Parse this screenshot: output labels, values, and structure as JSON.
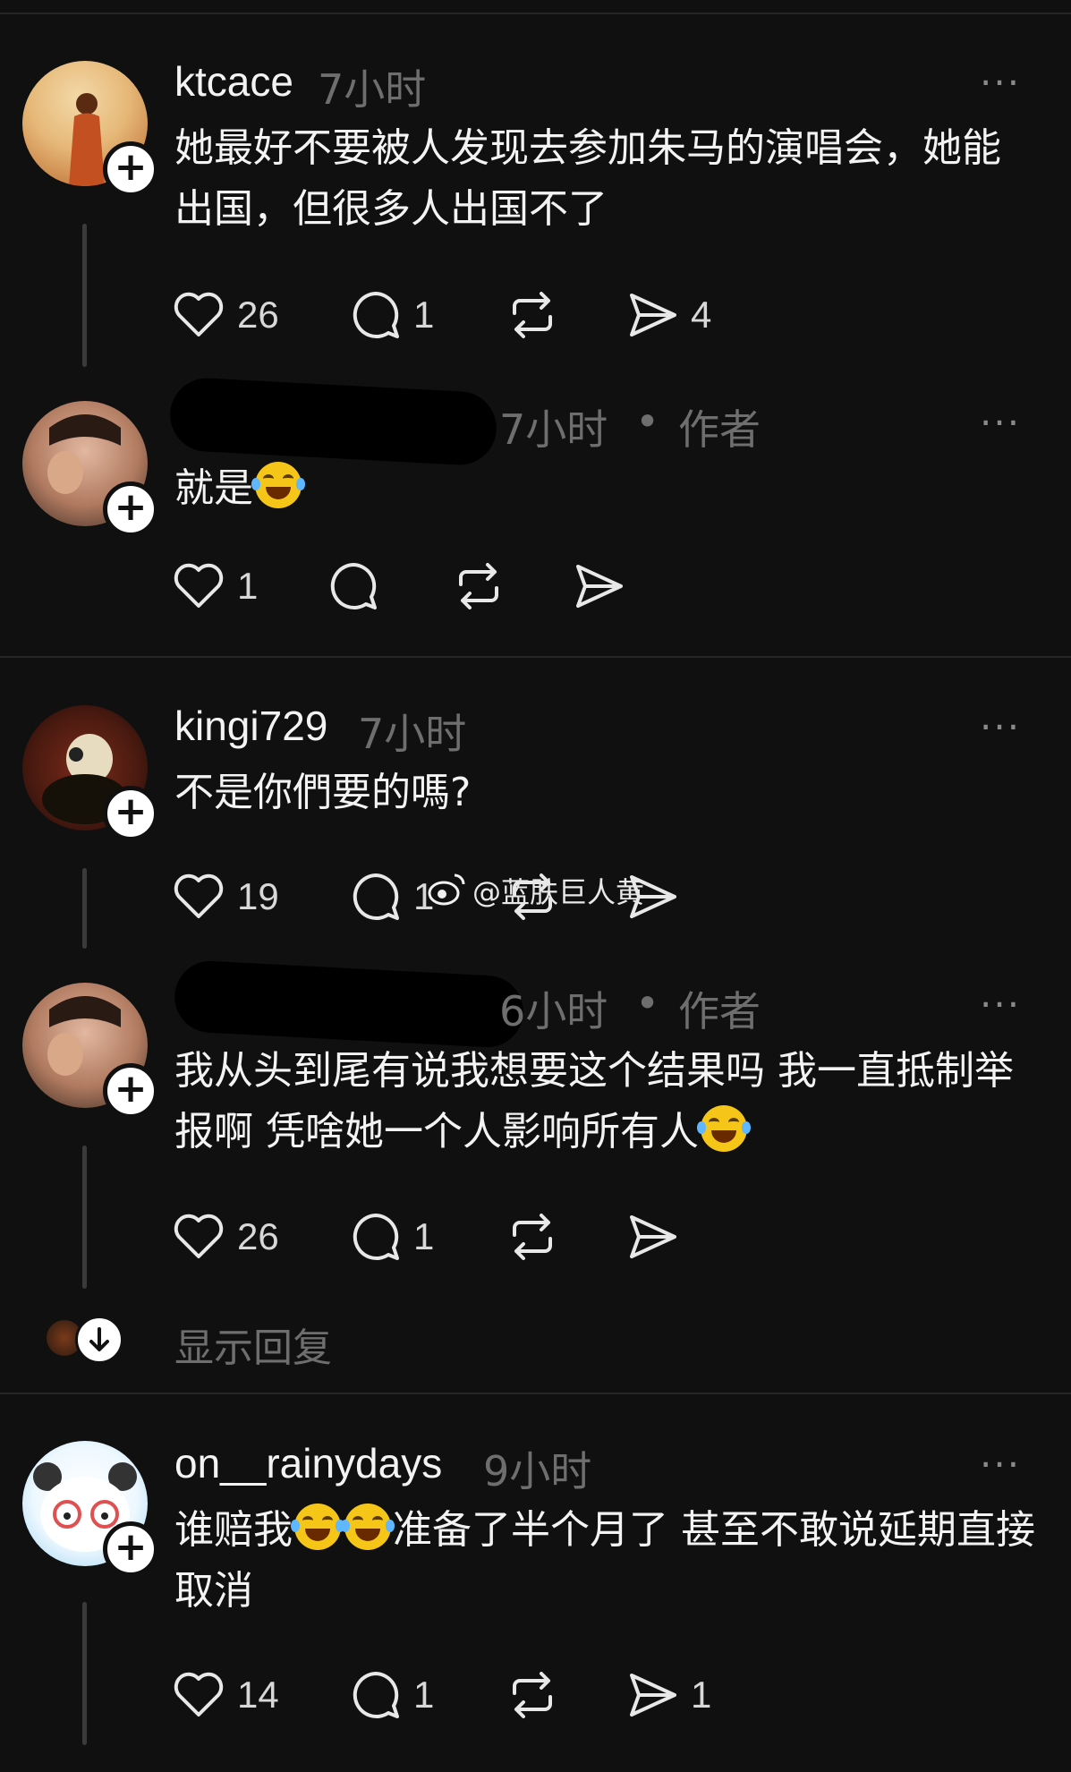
{
  "posts": [
    {
      "username": "ktcace",
      "time": "7小时",
      "author_tag": "",
      "body": "她最好不要被人发现去参加朱马的演唱会，她能出国，但很多人出国不了",
      "likes": "26",
      "replies": "1",
      "shares": "4"
    },
    {
      "username": "",
      "time": "7小时",
      "author_tag": "作者",
      "body": "就是",
      "likes": "1",
      "replies": "",
      "shares": ""
    },
    {
      "username": "kingi729",
      "time": "7小时",
      "author_tag": "",
      "body": "不是你們要的嗎?",
      "likes": "19",
      "replies": "1",
      "shares": ""
    },
    {
      "username": "",
      "time": "6小时",
      "author_tag": "作者",
      "body": "我从头到尾有说我想要这个结果吗 我一直抵制举报啊 凭啥她一个人影响所有人",
      "likes": "26",
      "replies": "1",
      "shares": ""
    },
    {
      "username": "on__rainydays",
      "time": "9小时",
      "author_tag": "",
      "body_prefix": "谁赔我",
      "body": "准备了半个月了 甚至不敢说延期直接取消",
      "likes": "14",
      "replies": "1",
      "shares": "1"
    }
  ],
  "show_replies": "显示回复",
  "separator_dot": "•",
  "more_label": "···",
  "watermark": "@蓝肤巨人黄",
  "icons": {
    "like": "heart-icon",
    "reply": "comment-icon",
    "repost": "repost-icon",
    "share": "send-icon",
    "follow": "plus-icon",
    "expand": "arrow-down-icon",
    "weibo": "weibo-logo-icon",
    "emoji": "tears-of-joy-emoji"
  }
}
